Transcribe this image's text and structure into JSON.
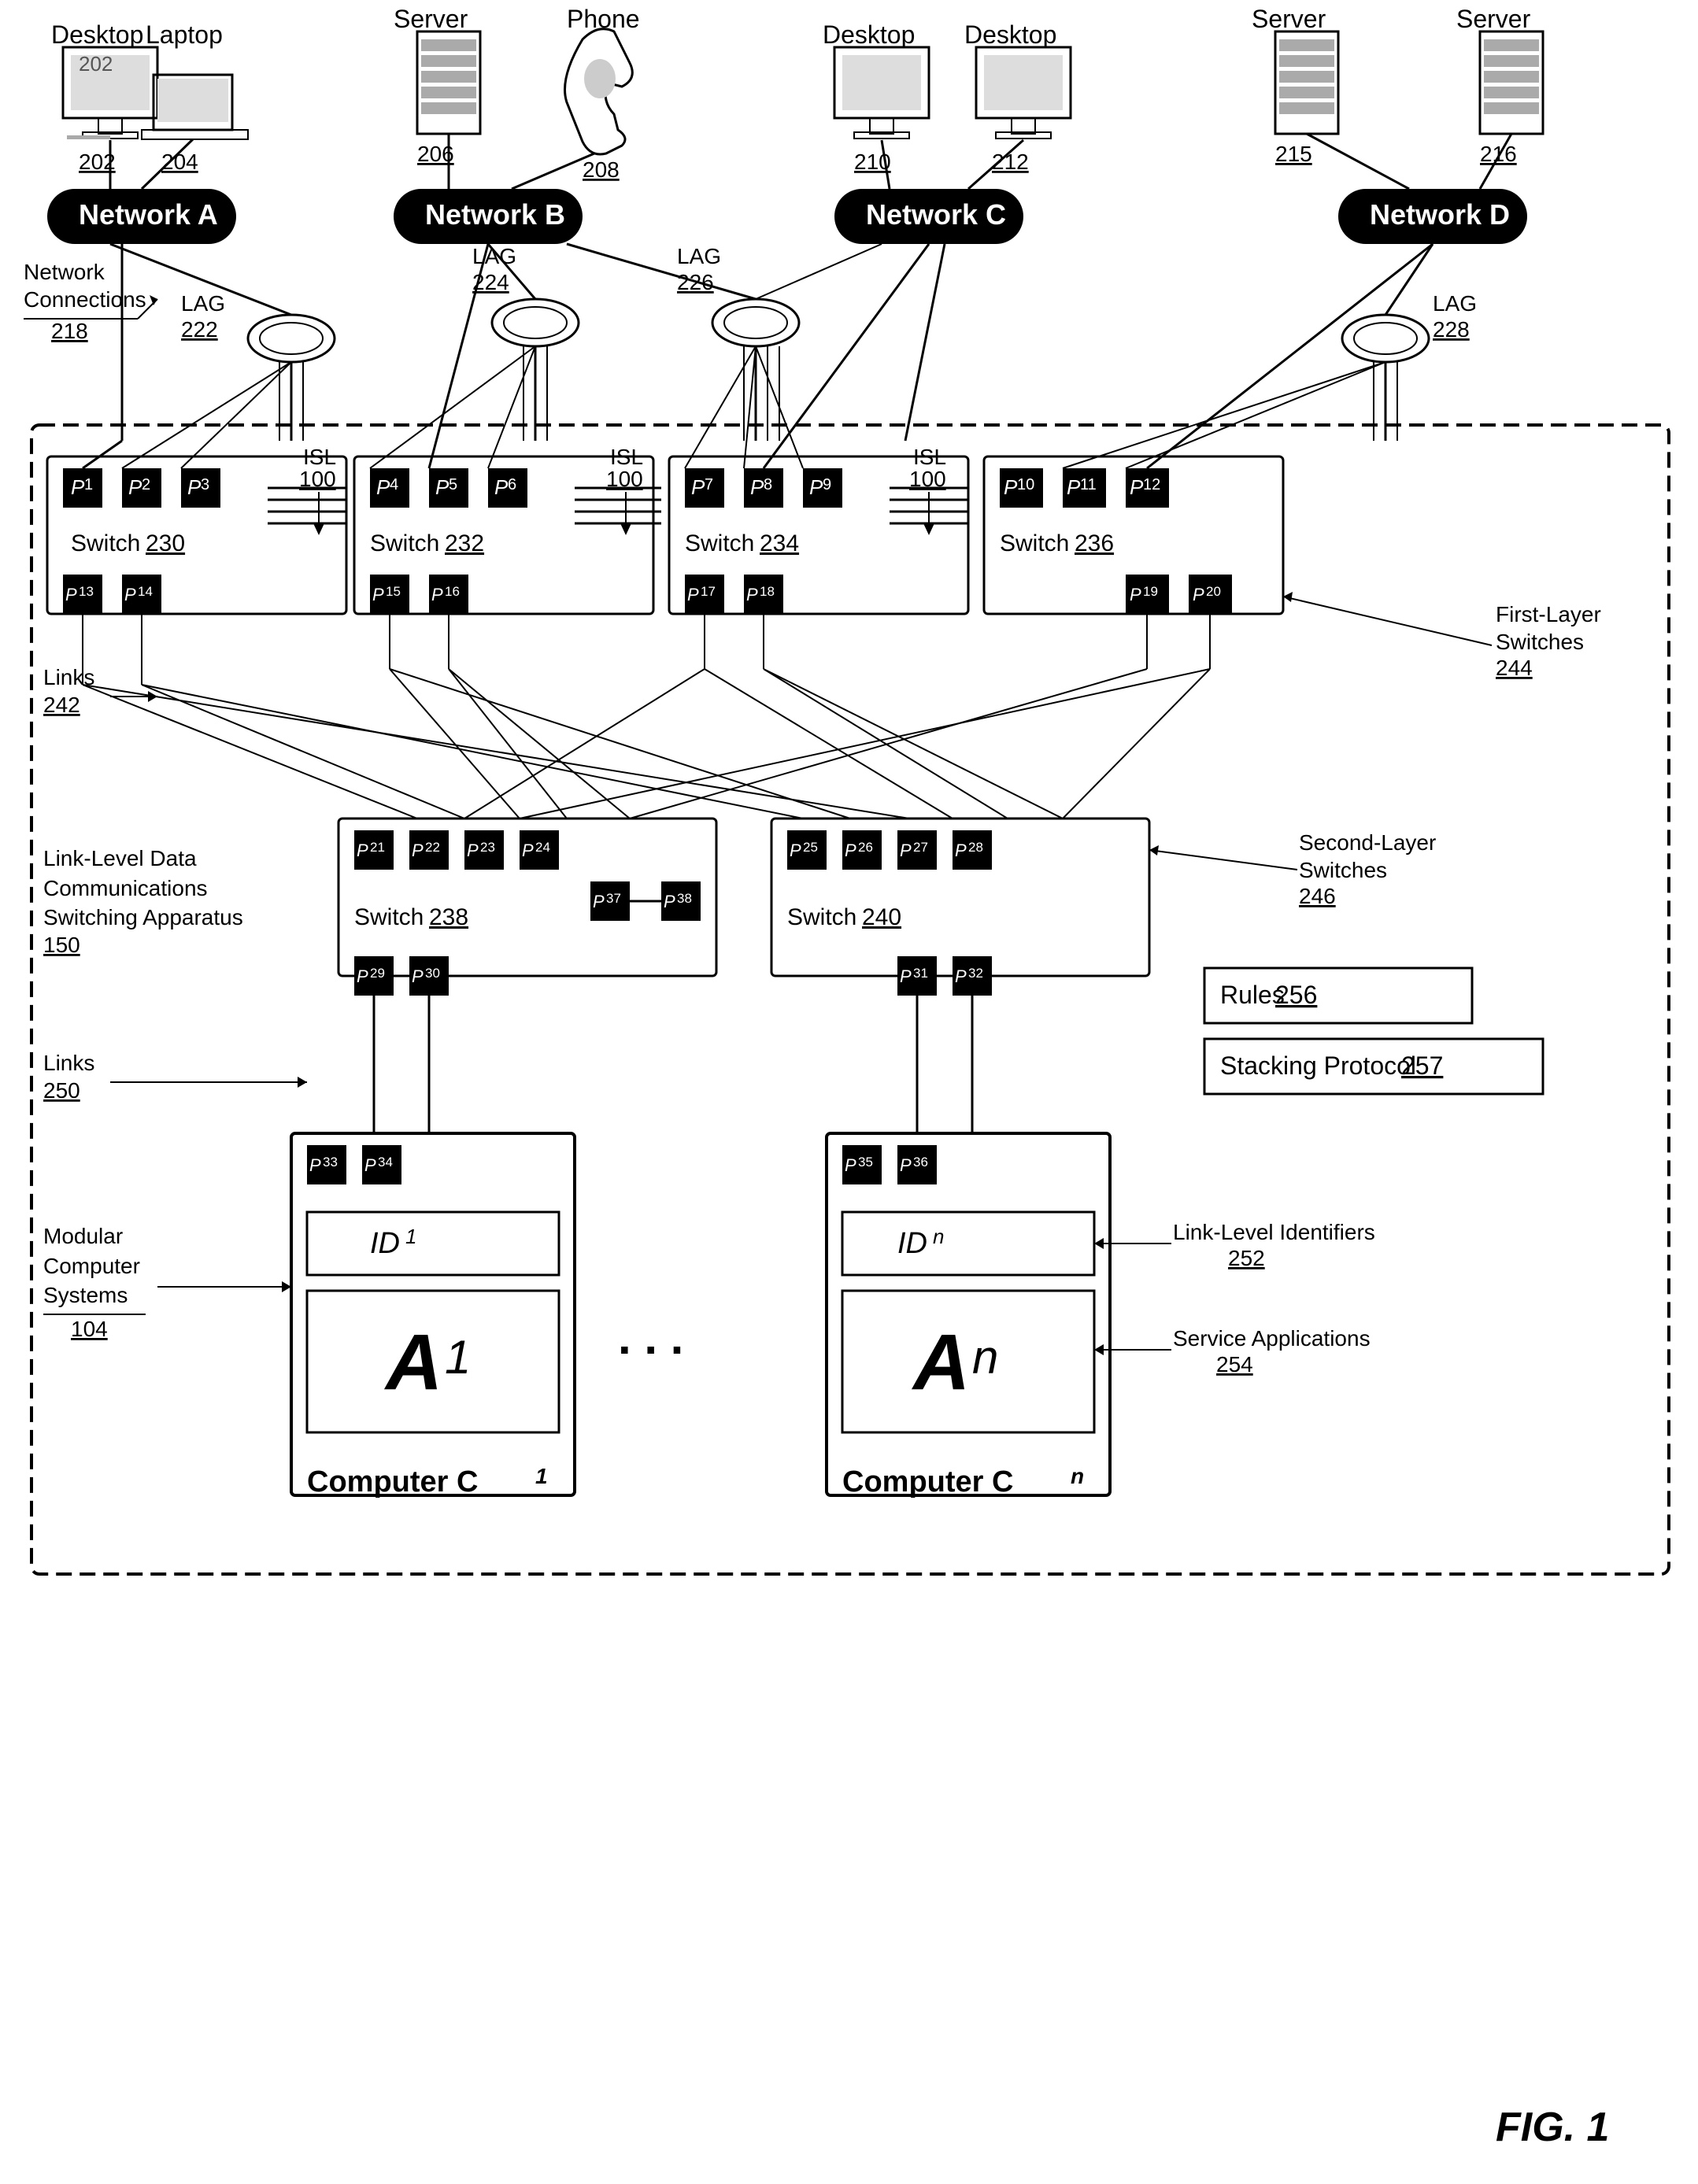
{
  "title": "FIG. 1 - Network Diagram",
  "fig_label": "FIG. 1",
  "devices": {
    "desktop202": {
      "label": "Desktop",
      "number": "202"
    },
    "laptop204": {
      "label": "Laptop",
      "number": "204"
    },
    "server206": {
      "label": "Server",
      "number": "206"
    },
    "phone208": {
      "label": "Phone",
      "number": "208"
    },
    "desktop210": {
      "label": "Desktop",
      "number": "210"
    },
    "desktop212": {
      "label": "Desktop",
      "number": "212"
    },
    "server215": {
      "label": "Server",
      "number": "215"
    },
    "server216": {
      "label": "Server",
      "number": "216"
    }
  },
  "networks": {
    "networkA": "Network A",
    "networkB": "Network B",
    "networkC": "Network C",
    "networkD": "Network D"
  },
  "connections": {
    "networkConnections218": "Network\nConnections\n218",
    "lag218": "218",
    "lag222": "LAG\n222",
    "lag224": "LAG\n224",
    "lag226": "LAG\n226",
    "lag228": "LAG\n228"
  },
  "switches": {
    "sw230": "Switch 230",
    "sw232": "Switch 232",
    "sw234": "Switch 234",
    "sw236": "Switch 236",
    "sw238": "Switch 238",
    "sw240": "Switch 240"
  },
  "isl": "ISL\n100",
  "links242": "Links 242",
  "links250": "Links 250",
  "labels": {
    "linkLevelData": "Link-Level Data\nCommunications\nSwitching Apparatus\n150",
    "modularComputer": "Modular\nComputer\nSystems\n104",
    "firstLayerSwitches": "First-Layer\nSwitches 244",
    "secondLayerSwitches": "Second-Layer\nSwitches 246",
    "rules256": "Rules 256",
    "stackingProtocol257": "Stacking Protocol 257",
    "linkLevelIdentifiers": "Link-Level Identifiers 252",
    "serviceApplications": "Service Applications 254"
  },
  "computers": {
    "c1": "Computer C1",
    "cn": "Computer Cn"
  },
  "ports": {
    "p1": "P1",
    "p2": "P2",
    "p3": "P3",
    "p4": "P4",
    "p5": "P5",
    "p6": "P6",
    "p7": "P7",
    "p8": "P8",
    "p9": "P9",
    "p10": "P10",
    "p11": "P11",
    "p12": "P12",
    "p13": "P13",
    "p14": "P14",
    "p15": "P15",
    "p16": "P16",
    "p17": "P17",
    "p18": "P18",
    "p19": "P19",
    "p20": "P20",
    "p21": "P21",
    "p22": "P22",
    "p23": "P23",
    "p24": "P24",
    "p25": "P25",
    "p26": "P26",
    "p27": "P27",
    "p28": "P28",
    "p29": "P29",
    "p30": "P30",
    "p31": "P31",
    "p32": "P32",
    "p33": "P33",
    "p34": "P34",
    "p35": "P35",
    "p36": "P36",
    "p37": "P37",
    "p38": "P38"
  }
}
